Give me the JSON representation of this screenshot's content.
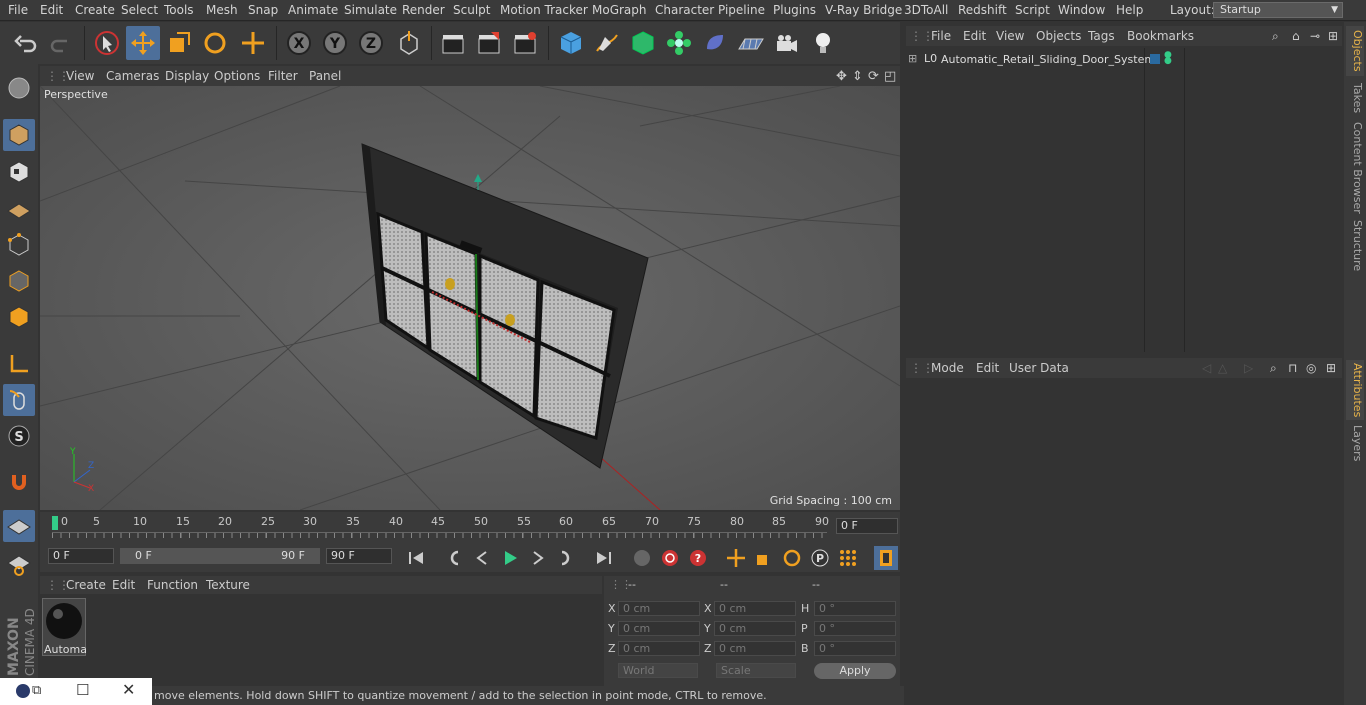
{
  "menubar": {
    "items": [
      "File",
      "Edit",
      "Create",
      "Select",
      "Tools",
      "Mesh",
      "Snap",
      "Animate",
      "Simulate",
      "Render",
      "Sculpt",
      "Motion Tracker",
      "MoGraph",
      "Character",
      "Pipeline",
      "Plugins",
      "V-Ray Bridge",
      "3DToAll",
      "Redshift",
      "Script",
      "Window",
      "Help"
    ],
    "layout_label": "Layout:",
    "layout_value": "Startup"
  },
  "viewport": {
    "menu": [
      "View",
      "Cameras",
      "Display",
      "Options",
      "Filter",
      "Panel"
    ],
    "label": "Perspective",
    "grid_spacing": "Grid Spacing : 100 cm"
  },
  "timeline": {
    "ticks": [
      "0",
      "5",
      "10",
      "15",
      "20",
      "25",
      "30",
      "35",
      "40",
      "45",
      "50",
      "55",
      "60",
      "65",
      "70",
      "75",
      "80",
      "85",
      "90"
    ],
    "current_frame": "0 F"
  },
  "transport": {
    "start_field": "0 F",
    "range_start": "0 F",
    "range_end": "90 F",
    "end_field": "90 F"
  },
  "material": {
    "menu": [
      "Create",
      "Edit",
      "Function",
      "Texture"
    ],
    "item_label": "Automa"
  },
  "coordinates": {
    "headers": [
      "--",
      "--",
      "--"
    ],
    "rows": [
      {
        "a": "X",
        "av": "0 cm",
        "b": "X",
        "bv": "0 cm",
        "c": "H",
        "cv": "0 °"
      },
      {
        "a": "Y",
        "av": "0 cm",
        "b": "Y",
        "bv": "0 cm",
        "c": "P",
        "cv": "0 °"
      },
      {
        "a": "Z",
        "av": "0 cm",
        "b": "Z",
        "bv": "0 cm",
        "c": "B",
        "cv": "0 °"
      }
    ],
    "mode_select": "World",
    "size_select": "Scale",
    "apply_label": "Apply"
  },
  "status": {
    "text": "move elements. Hold down SHIFT to quantize movement / add to the selection in point mode, CTRL to remove."
  },
  "object_manager": {
    "menu": [
      "File",
      "Edit",
      "View",
      "Objects",
      "Tags",
      "Bookmarks"
    ],
    "object_name": "Automatic_Retail_Sliding_Door_System"
  },
  "attributes": {
    "menu": [
      "Mode",
      "Edit",
      "User Data"
    ]
  },
  "side_tabs": [
    "Objects",
    "Takes",
    "Content Browser",
    "Structure"
  ],
  "side_tabs2": [
    "Attributes",
    "Layers"
  ],
  "logo": {
    "brand": "MAXON",
    "product": "CINEMA 4D"
  },
  "colors": {
    "accent": "#4d6f9a",
    "tab_active": "#e8b44a"
  }
}
